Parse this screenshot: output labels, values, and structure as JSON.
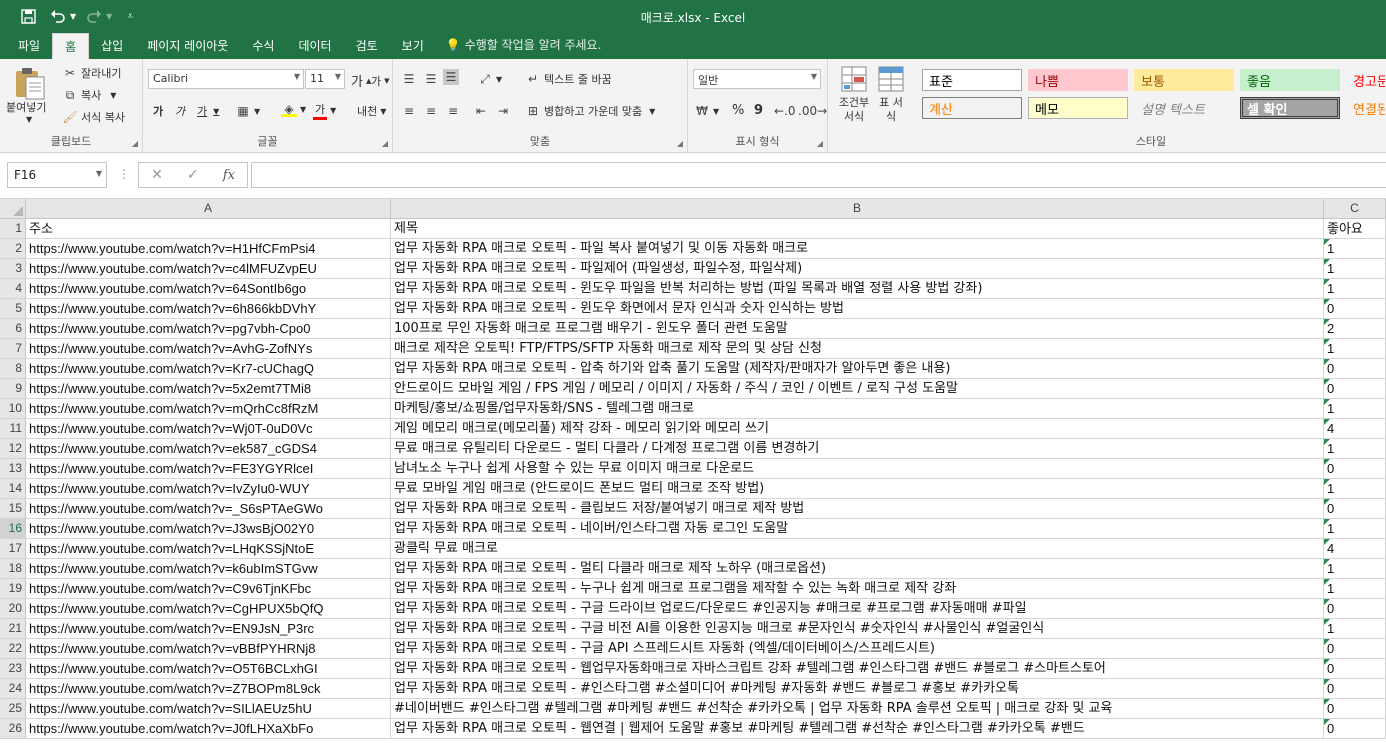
{
  "window": {
    "title": "매크로.xlsx - Excel"
  },
  "tabs": [
    "파일",
    "홈",
    "삽입",
    "페이지 레이아웃",
    "수식",
    "데이터",
    "검토",
    "보기"
  ],
  "active_tab": "홈",
  "tellme": "수행할 작업을 알려 주세요.",
  "ribbon": {
    "clipboard": {
      "label": "클립보드",
      "paste": "붙여넣기",
      "cut": "잘라내기",
      "copy": "복사",
      "format_painter": "서식 복사"
    },
    "font": {
      "label": "글꼴",
      "name": "Calibri",
      "size": "11",
      "grow": "가",
      "shrink": "가",
      "bold": "가",
      "italic": "가",
      "underline": "가",
      "font_color": "가",
      "phonetic": "내천"
    },
    "alignment": {
      "label": "맞춤",
      "wrap_text": "텍스트 줄 바꿈",
      "merge_center": "병합하고 가운데 맞춤"
    },
    "number": {
      "label": "표시 형식",
      "format": "일반",
      "percent": "%",
      "comma": "9"
    },
    "cells": {
      "conditional": "조건부 서식",
      "table": "표 서식"
    },
    "styles": {
      "label": "스타일",
      "items": [
        {
          "name": "표준",
          "bg": "#ffffff",
          "fg": "#000000",
          "border": "#a6a6a6"
        },
        {
          "name": "나쁨",
          "bg": "#ffc7ce",
          "fg": "#9c0006",
          "border": "#ffc7ce"
        },
        {
          "name": "보통",
          "bg": "#ffeb9c",
          "fg": "#9c5700",
          "border": "#ffeb9c"
        },
        {
          "name": "좋음",
          "bg": "#c6efce",
          "fg": "#006100",
          "border": "#c6efce"
        },
        {
          "name": "경고문",
          "bg": "#f3f3f3",
          "fg": "#ff0000",
          "border": "#f3f3f3"
        },
        {
          "name": "계산",
          "bg": "#f2f2f2",
          "fg": "#fa7d00",
          "border": "#7f7f7f"
        },
        {
          "name": "메모",
          "bg": "#ffffcc",
          "fg": "#000000",
          "border": "#b2b2b2"
        },
        {
          "name": "설명 텍스트",
          "bg": "#f3f3f3",
          "fg": "#7f7f7f",
          "border": "#f3f3f3"
        },
        {
          "name": "셀 확인",
          "bg": "#a5a5a5",
          "fg": "#ffffff",
          "border": "#3f3f3f"
        },
        {
          "name": "연결된",
          "bg": "#f3f3f3",
          "fg": "#fa7d00",
          "border": "#f3f3f3"
        }
      ]
    }
  },
  "formula_bar": {
    "name_box": "F16",
    "cancel": "✕",
    "enter": "✓",
    "fx": "fx",
    "value": ""
  },
  "columns": [
    "A",
    "B",
    "C"
  ],
  "selected_row": 16,
  "header_row": {
    "a": "주소",
    "b": "제목",
    "c": "좋아요"
  },
  "rows": [
    {
      "n": "2",
      "a": "https://www.youtube.com/watch?v=H1HfCFmPsi4",
      "b": "업무 자동화 RPA 매크로 오토픽 - 파일 복사 붙여넣기 및 이동 자동화 매크로",
      "c": "1"
    },
    {
      "n": "3",
      "a": "https://www.youtube.com/watch?v=c4lMFUZvpEU",
      "b": "업무 자동화 RPA 매크로 오토픽 - 파일제어 (파일생성, 파일수정, 파일삭제)",
      "c": "1"
    },
    {
      "n": "4",
      "a": "https://www.youtube.com/watch?v=64SontIb6go",
      "b": "업무 자동화 RPA 매크로 오토픽 - 윈도우 파일을 반복 처리하는 방법 (파일 목록과 배열 정렬 사용 방법 강좌)",
      "c": "1"
    },
    {
      "n": "5",
      "a": "https://www.youtube.com/watch?v=6h866kbDVhY",
      "b": "업무 자동화 RPA 매크로 오토픽 - 윈도우 화면에서 문자 인식과 숫자 인식하는 방법",
      "c": "0"
    },
    {
      "n": "6",
      "a": "https://www.youtube.com/watch?v=pg7vbh-Cpo0",
      "b": "100프로 무인 자동화 매크로 프로그램 배우기 - 윈도우 폴더 관련 도움말",
      "c": "2"
    },
    {
      "n": "7",
      "a": "https://www.youtube.com/watch?v=AvhG-ZofNYs",
      "b": "매크로 제작은 오토픽! FTP/FTPS/SFTP 자동화 매크로 제작 문의 및 상담 신청",
      "c": "1"
    },
    {
      "n": "8",
      "a": "https://www.youtube.com/watch?v=Kr7-cUChagQ",
      "b": "업무 자동화 RPA 매크로 오토픽 - 압축 하기와 압축 풀기 도움말 (제작자/판매자가 알아두면 좋은 내용)",
      "c": "0"
    },
    {
      "n": "9",
      "a": "https://www.youtube.com/watch?v=5x2emt7TMi8",
      "b": "안드로이드 모바일 게임 / FPS 게임 / 메모리 / 이미지 / 자동화 / 주식 / 코인 / 이벤트 / 로직 구성 도움말",
      "c": "0"
    },
    {
      "n": "10",
      "a": "https://www.youtube.com/watch?v=mQrhCc8fRzM",
      "b": "마케팅/홍보/쇼핑몰/업무자동화/SNS - 텔레그램 매크로",
      "c": "1"
    },
    {
      "n": "11",
      "a": "https://www.youtube.com/watch?v=Wj0T-0uD0Vc",
      "b": "게임 메모리 매크로(메모리풀) 제작 강좌 - 메모리 읽기와 메모리 쓰기",
      "c": "4"
    },
    {
      "n": "12",
      "a": "https://www.youtube.com/watch?v=ek587_cGDS4",
      "b": "무료 매크로 유틸리티 다운로드 - 멀티 다클라 / 다계정 프로그램 이름 변경하기",
      "c": "1"
    },
    {
      "n": "13",
      "a": "https://www.youtube.com/watch?v=FE3YGYRlceI",
      "b": "남녀노소 누구나 쉽게 사용할 수 있는 무료 이미지 매크로 다운로드",
      "c": "0"
    },
    {
      "n": "14",
      "a": "https://www.youtube.com/watch?v=IvZyIu0-WUY",
      "b": "무료 모바일 게임 매크로 (안드로이드 폰보드 멀티 매크로 조작 방법)",
      "c": "1"
    },
    {
      "n": "15",
      "a": "https://www.youtube.com/watch?v=_S6sPTAeGWo",
      "b": "업무 자동화 RPA 매크로 오토픽 - 클립보드 저장/붙여넣기 매크로 제작 방법",
      "c": "0"
    },
    {
      "n": "16",
      "a": "https://www.youtube.com/watch?v=J3wsBjO02Y0",
      "b": "업무 자동화 RPA 매크로 오토픽 - 네이버/인스타그램 자동 로그인 도움말",
      "c": "1"
    },
    {
      "n": "17",
      "a": "https://www.youtube.com/watch?v=LHqKSSjNtoE",
      "b": "광클릭 무료 매크로",
      "c": "4"
    },
    {
      "n": "18",
      "a": "https://www.youtube.com/watch?v=k6ubImSTGvw",
      "b": "업무 자동화 RPA 매크로 오토픽 - 멀티 다클라 매크로 제작 노하우 (매크로옵션)",
      "c": "1"
    },
    {
      "n": "19",
      "a": "https://www.youtube.com/watch?v=C9v6TjnKFbc",
      "b": "업무 자동화 RPA 매크로 오토픽 - 누구나 쉽게 매크로 프로그램을 제작할 수 있는 녹화 매크로 제작 강좌",
      "c": "1"
    },
    {
      "n": "20",
      "a": "https://www.youtube.com/watch?v=CgHPUX5bQfQ",
      "b": "업무 자동화 RPA 매크로 오토픽 - 구글 드라이브 업로드/다운로드 #인공지능 #매크로 #프로그램 #자동매매 #파일",
      "c": "0"
    },
    {
      "n": "21",
      "a": "https://www.youtube.com/watch?v=EN9JsN_P3rc",
      "b": "업무 자동화 RPA 매크로 오토픽 - 구글 비전 AI를 이용한 인공지능 매크로 #문자인식 #숫자인식 #사물인식 #얼굴인식",
      "c": "1"
    },
    {
      "n": "22",
      "a": "https://www.youtube.com/watch?v=vBBfPYHRNj8",
      "b": "업무 자동화 RPA 매크로 오토픽 - 구글 API 스프레드시트 자동화 (엑셀/데이터베이스/스프레드시트)",
      "c": "0"
    },
    {
      "n": "23",
      "a": "https://www.youtube.com/watch?v=O5T6BCLxhGI",
      "b": "업무 자동화 RPA 매크로 오토픽 - 웹업무자동화매크로 자바스크립트 강좌 #텔레그램 #인스타그램 #밴드 #블로그 #스마트스토어",
      "c": "0"
    },
    {
      "n": "24",
      "a": "https://www.youtube.com/watch?v=Z7BOPm8L9ck",
      "b": "업무 자동화 RPA 매크로 오토픽 - #인스타그램 #소셜미디어 #마케팅 #자동화 #밴드 #블로그 #홍보 #카카오톡",
      "c": "0"
    },
    {
      "n": "25",
      "a": "https://www.youtube.com/watch?v=SILlAEUz5hU",
      "b": "#네이버밴드 #인스타그램 #텔레그램 #마케팅 #밴드 #선착순 #카카오톡 | 업무 자동화 RPA 솔루션 오토픽 | 매크로 강좌 및 교육",
      "c": "0"
    },
    {
      "n": "26",
      "a": "https://www.youtube.com/watch?v=J0fLHXaXbFo",
      "b": "업무 자동화 RPA 매크로 오토픽 - 웹연결 | 웹제어 도움말 #홍보 #마케팅 #텔레그램 #선착순 #인스타그램 #카카오톡 #밴드",
      "c": "0"
    }
  ]
}
